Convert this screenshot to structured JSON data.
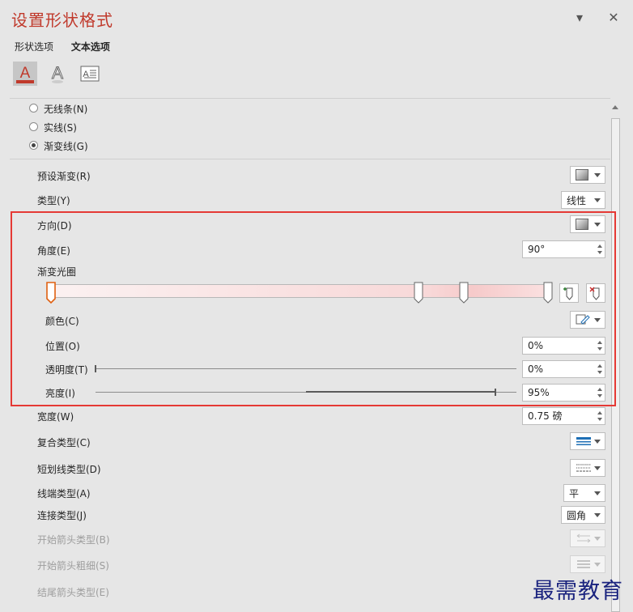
{
  "panel": {
    "title": "设置形状格式",
    "dropdown_glyph": "▾",
    "close_glyph": "✕"
  },
  "tabs": {
    "shape_options": "形状选项",
    "text_options": "文本选项"
  },
  "icons": [
    "text-fill-outline-icon",
    "text-effects-icon",
    "textbox-icon"
  ],
  "line": {
    "no_line": "无线条(N)",
    "solid_line": "实线(S)",
    "gradient_line": "渐变线(G)",
    "selected": "gradient_line"
  },
  "gradient": {
    "preset_label": "预设渐变(R)",
    "type_label": "类型(Y)",
    "type_value": "线性",
    "direction_label": "方向(D)",
    "angle_label": "角度(E)",
    "angle_value": "90°",
    "stops_label": "渐变光圈",
    "stop_positions": [
      0,
      74,
      83,
      100
    ],
    "selected_stop": 0,
    "color_label": "颜色(C)",
    "position_label": "位置(O)",
    "position_value": "0%",
    "transparency_label": "透明度(T)",
    "transparency_value": "0%",
    "transparency_level": 0,
    "brightness_label": "亮度(I)",
    "brightness_value": "95%",
    "brightness_level": 95
  },
  "properties": {
    "width_label": "宽度(W)",
    "width_value": "0.75 磅",
    "compound_label": "复合类型(C)",
    "dash_label": "短划线类型(D)",
    "cap_label": "线端类型(A)",
    "cap_value": "平",
    "join_label": "连接类型(J)",
    "join_value": "圆角",
    "begin_arrow_type_label": "开始箭头类型(B)",
    "begin_arrow_size_label": "开始箭头粗细(S)",
    "end_arrow_type_label": "结尾箭头类型(E)"
  },
  "colors": {
    "title": "#c0392b",
    "highlight_box": "#e53935",
    "watermark": "#1a237e"
  },
  "watermark": "最需教育"
}
